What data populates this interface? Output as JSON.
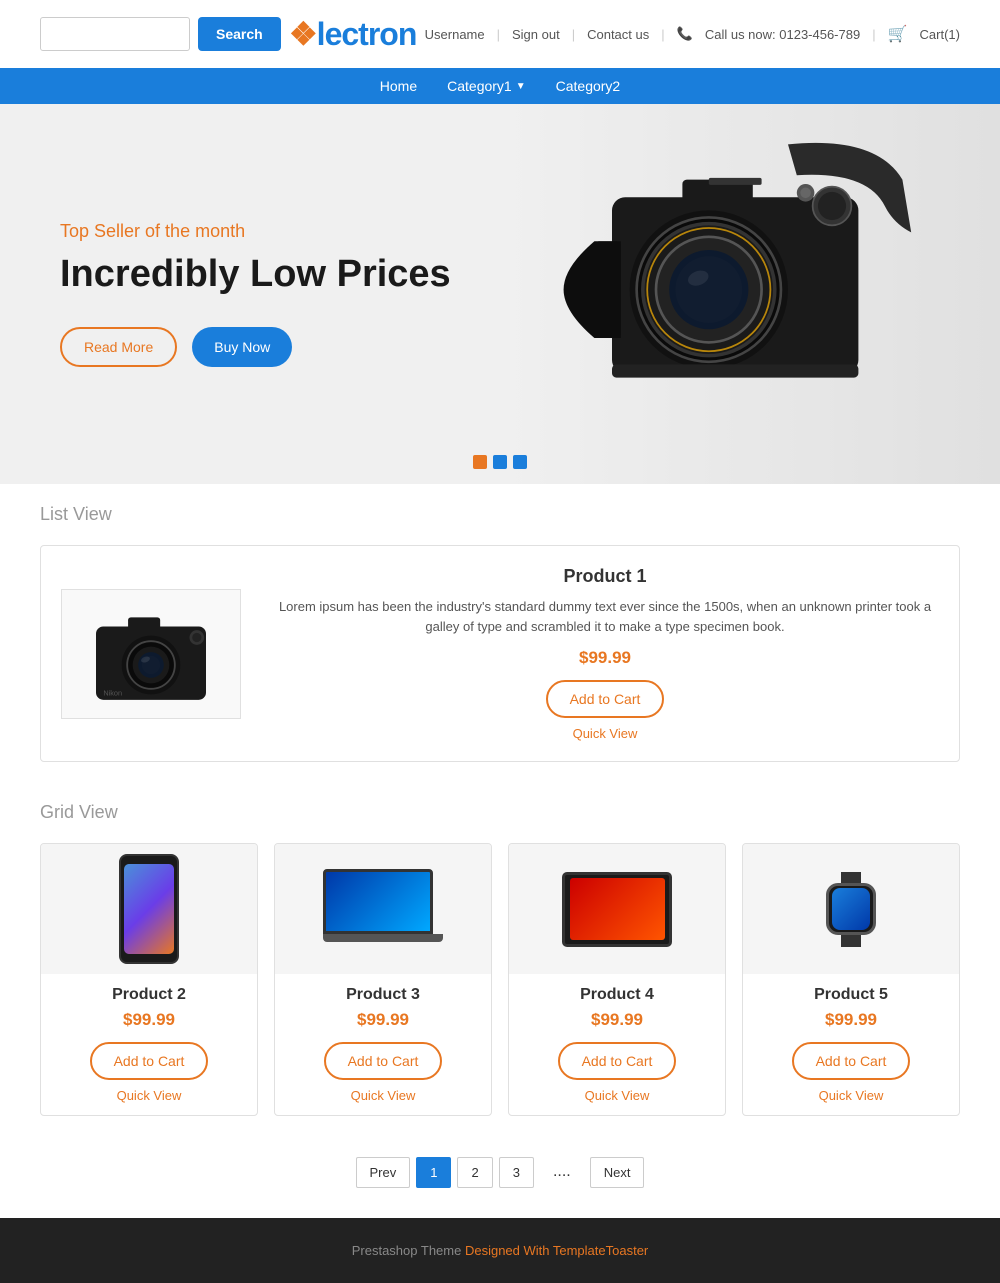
{
  "header": {
    "search_placeholder": "",
    "search_button": "Search",
    "logo_prefix": "lectron",
    "logo_brand": "Electron",
    "nav_links": [
      {
        "label": "Username",
        "href": "#"
      },
      {
        "label": "Sign out",
        "href": "#"
      },
      {
        "label": "Contact us",
        "href": "#"
      },
      {
        "label": "Call us now: 0123-456-789",
        "href": "#"
      },
      {
        "label": "Cart(1)",
        "href": "#"
      }
    ]
  },
  "nav": {
    "items": [
      {
        "label": "Home",
        "has_dropdown": false
      },
      {
        "label": "Category1",
        "has_dropdown": true
      },
      {
        "label": "Category2",
        "has_dropdown": false
      }
    ]
  },
  "hero": {
    "subtitle": "Top Seller of the month",
    "title": "Incredibly Low Prices",
    "btn_read_more": "Read More",
    "btn_buy_now": "Buy Now",
    "dots": [
      {
        "type": "active"
      },
      {
        "type": "inactive"
      },
      {
        "type": "inactive"
      }
    ]
  },
  "list_view": {
    "section_title": "List View",
    "product": {
      "name": "Product 1",
      "description": "Lorem ipsum has been the industry's standard dummy text ever since the 1500s, when an unknown printer took a galley of type and scrambled it to make a type specimen book.",
      "price": "$99.99",
      "btn_cart": "Add to Cart",
      "btn_quick_view": "Quick View"
    }
  },
  "grid_view": {
    "section_title": "Grid View",
    "products": [
      {
        "name": "Product 2",
        "price": "$99.99",
        "btn_cart": "Add to Cart",
        "btn_quick_view": "Quick View",
        "type": "phone"
      },
      {
        "name": "Product 3",
        "price": "$99.99",
        "btn_cart": "Add to Cart",
        "btn_quick_view": "Quick View",
        "type": "laptop"
      },
      {
        "name": "Product 4",
        "price": "$99.99",
        "btn_cart": "Add to Cart",
        "btn_quick_view": "Quick View",
        "type": "tablet"
      },
      {
        "name": "Product 5",
        "price": "$99.99",
        "btn_cart": "Add to Cart",
        "btn_quick_view": "Quick View",
        "type": "watch"
      }
    ]
  },
  "pagination": {
    "prev": "Prev",
    "next": "Next",
    "pages": [
      "1",
      "2",
      "3",
      "...."
    ]
  },
  "footer": {
    "text": "Prestashop Theme ",
    "link_text": "Designed With TemplateToaster"
  },
  "colors": {
    "orange": "#e87722",
    "blue": "#1a7edb",
    "dark": "#1a1a1a"
  }
}
